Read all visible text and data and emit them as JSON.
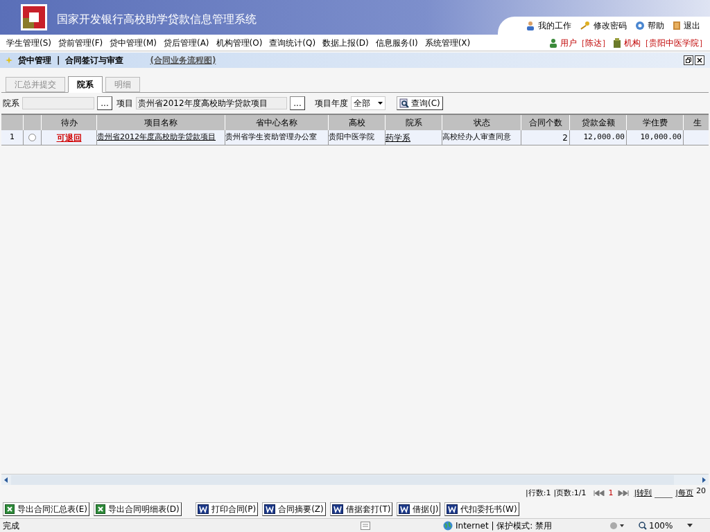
{
  "header": {
    "title": "国家开发银行高校助学贷款信息管理系统",
    "links": [
      {
        "label": "我的工作",
        "kind": "person"
      },
      {
        "label": "修改密码",
        "kind": "key"
      },
      {
        "label": "帮助",
        "kind": "help"
      },
      {
        "label": "退出",
        "kind": "exit"
      }
    ]
  },
  "menu": {
    "items": [
      "学生管理(S)",
      "贷前管理(F)",
      "贷中管理(M)",
      "贷后管理(A)",
      "机构管理(O)",
      "查询统计(Q)",
      "数据上报(D)",
      "信息服务(I)",
      "系统管理(X)"
    ],
    "user": "用户［陈达］",
    "org": "机构［贵阳中医学院］"
  },
  "breadcrumb": {
    "section": "贷中管理",
    "separator": "|",
    "page": "合同签订与审查",
    "link": "(合同业务流程图)"
  },
  "tabs": [
    {
      "label": "汇总并提交",
      "selected": false
    },
    {
      "label": "院系",
      "selected": true
    },
    {
      "label": "明细",
      "selected": false
    }
  ],
  "filters": {
    "dept_label": "院系",
    "browse": "...",
    "project_label": "项目",
    "project_value": "贵州省2012年度高校助学贷款项目",
    "project_browse": "...",
    "year_label": "项目年度",
    "year_value": "全部",
    "query": "查询(C)"
  },
  "table": {
    "columns": [
      "",
      "",
      "待办",
      "项目名称",
      "省中心名称",
      "高校",
      "院系",
      "状态",
      "合同个数",
      "贷款金额",
      "学住费",
      "生"
    ],
    "rows": [
      {
        "index": "1",
        "selected": false,
        "todo": "可退回",
        "project": "贵州省2012年度高校助学贷款项目",
        "center": "贵州省学生资助管理办公室",
        "school": "贵阳中医学院",
        "dept": "药学系",
        "status": "高校经办人审查同意",
        "count": "2",
        "amount": "12,000.00",
        "fee": "10,000.00"
      }
    ]
  },
  "pager": {
    "rows": "|行数:1",
    "pages": "|页数:1/1",
    "current": "1",
    "goto": "|转到",
    "per_page": "|每页",
    "per_page_value": "20"
  },
  "toolbar": [
    {
      "label": "导出合同汇总表(E)",
      "kind": "excel"
    },
    {
      "label": "导出合同明细表(D)",
      "kind": "excel"
    },
    {
      "label": "打印合同(P)",
      "kind": "word"
    },
    {
      "label": "合同摘要(Z)",
      "kind": "word"
    },
    {
      "label": "借据套打(T)",
      "kind": "word"
    },
    {
      "label": "借据(J)",
      "kind": "word"
    },
    {
      "label": "代扣委托书(W)",
      "kind": "word"
    }
  ],
  "status_bar": {
    "text": "完成",
    "zone": "Internet | 保护模式: 禁用",
    "zoom": "100%"
  }
}
